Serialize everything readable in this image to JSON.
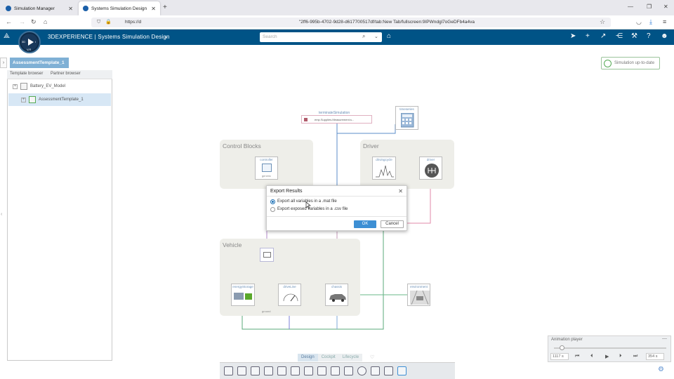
{
  "browser": {
    "tabs": [
      {
        "label": "Simulation Manager",
        "active": false
      },
      {
        "label": "Systems Simulation Design",
        "active": true
      }
    ],
    "url_prefix": "https://d",
    "url_rest": "\"2ff6-995b-4702-9d28-d617700517df/tab:New Tab/fullscreen:9IPWndgl7oGeDFb4a4va"
  },
  "app": {
    "brand": "3DEXPERIENCE | Systems Simulation Design",
    "search_placeholder": "Search",
    "logo_text": "V,R"
  },
  "breadcrumb": "AssessmentTemplate_1",
  "left_panel": {
    "tabs": [
      "Template browser",
      "Partner browser"
    ],
    "tree": [
      {
        "label": "Battery_EV_Model",
        "selected": false
      },
      {
        "label": "AssessmentTemplate_1",
        "selected": true
      }
    ]
  },
  "status_button": "Simulation up-to-date",
  "canvas": {
    "groups": {
      "control": "Control Blocks",
      "driver": "Driver",
      "vehicle": "Vehicle"
    },
    "blocks": {
      "terminate": "terminateSimulation",
      "terminate_text": "emp.Supplies.Measurement.s...",
      "datalogger": "timeseries",
      "controller": "controller",
      "controller_sub": "generic",
      "drivecycle": "drivingcycle",
      "driver": "driver",
      "energy": "energyStorage",
      "driveline": "driveLine",
      "chassis": "chassis",
      "environment": "environment",
      "ground": "ground"
    }
  },
  "dialog": {
    "title": "Export Results",
    "options": [
      {
        "label": "Export all variables in a .mat file",
        "selected": true
      },
      {
        "label": "Export exposed variables in a .csv file",
        "selected": false
      }
    ],
    "ok": "OK",
    "cancel": "Cancel"
  },
  "view_tabs": [
    "Design",
    "Cockpit",
    "Lifecycle"
  ],
  "animation_player": {
    "title": "Animation player",
    "start_time": "1117 s",
    "end_time": "354 s",
    "position": 0.07
  }
}
